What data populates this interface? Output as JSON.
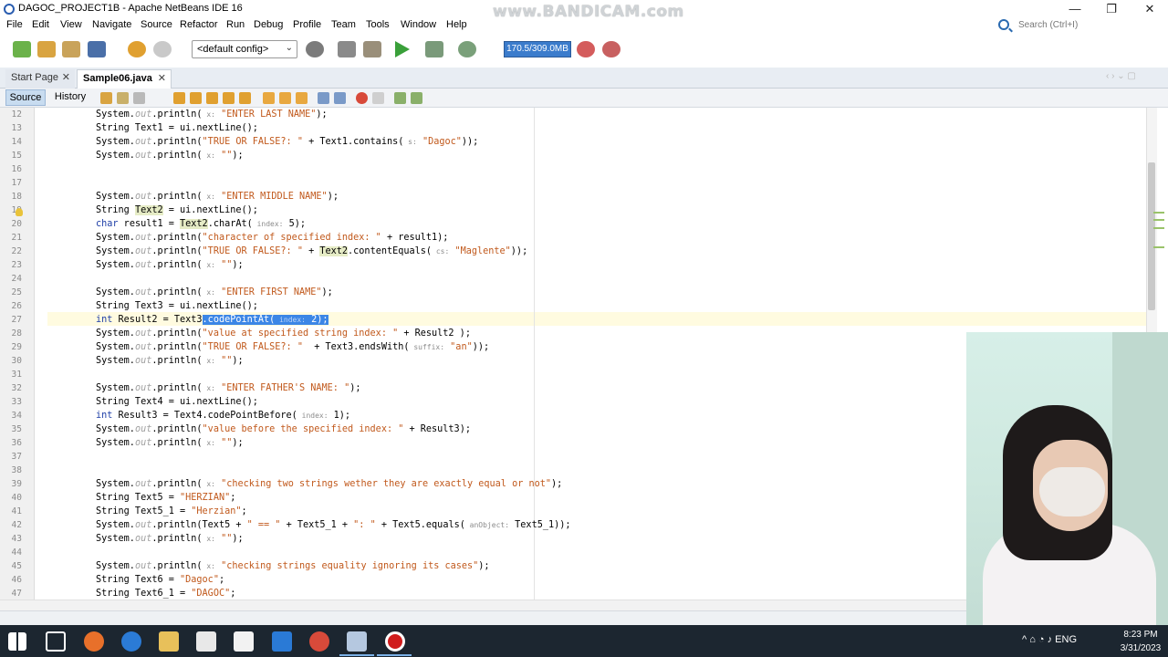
{
  "window": {
    "title": "DAGOC_PROJECT1B - Apache NetBeans IDE 16",
    "watermark": "www.BANDICAM.com",
    "minimize": "—",
    "maximize": "❐",
    "close": "✕"
  },
  "menu": [
    "File",
    "Edit",
    "View",
    "Navigate",
    "Source",
    "Refactor",
    "Run",
    "Debug",
    "Profile",
    "Team",
    "Tools",
    "Window",
    "Help"
  ],
  "search": {
    "placeholder": "Search (Ctrl+I)"
  },
  "toolbar": {
    "config": "<default config>",
    "memory": "170.5/309.0MB"
  },
  "tabs": [
    {
      "label": "Start Page",
      "close": "✕"
    },
    {
      "label": "Sample06.java",
      "close": "✕"
    }
  ],
  "editor_modes": {
    "source": "Source",
    "history": "History"
  },
  "code_lines": [
    {
      "n": "12",
      "text": "System.out.println( x: \"ENTER LAST NAME\");"
    },
    {
      "n": "13",
      "text": "String Text1 = ui.nextLine();"
    },
    {
      "n": "14",
      "text": "System.out.println(\"TRUE OR FALSE?: \" + Text1.contains( s: \"Dagoc\"));"
    },
    {
      "n": "15",
      "text": "System.out.println( x: \"\");"
    },
    {
      "n": "16",
      "text": ""
    },
    {
      "n": "17",
      "text": ""
    },
    {
      "n": "18",
      "text": "System.out.println( x: \"ENTER MIDDLE NAME\");"
    },
    {
      "n": "19",
      "text": "String Text2 = ui.nextLine();"
    },
    {
      "n": "20",
      "text": "char result1 = Text2.charAt( index: 5);"
    },
    {
      "n": "21",
      "text": "System.out.println(\"character of specified index: \" + result1);"
    },
    {
      "n": "22",
      "text": "System.out.println(\"TRUE OR FALSE?: \" + Text2.contentEquals( cs: \"Maglente\"));"
    },
    {
      "n": "23",
      "text": "System.out.println( x: \"\");"
    },
    {
      "n": "24",
      "text": ""
    },
    {
      "n": "25",
      "text": "System.out.println( x: \"ENTER FIRST NAME\");"
    },
    {
      "n": "26",
      "text": "String Text3 = ui.nextLine();"
    },
    {
      "n": "27",
      "text": "int Result2 = Text3.codePointAt( index: 2);"
    },
    {
      "n": "28",
      "text": "System.out.println(\"value at specified string index: \" + Result2 );"
    },
    {
      "n": "29",
      "text": "System.out.println(\"TRUE OR FALSE?: \"  + Text3.endsWith( suffix: \"an\"));"
    },
    {
      "n": "30",
      "text": "System.out.println( x: \"\");"
    },
    {
      "n": "31",
      "text": ""
    },
    {
      "n": "32",
      "text": "System.out.println( x: \"ENTER FATHER'S NAME: \");"
    },
    {
      "n": "33",
      "text": "String Text4 = ui.nextLine();"
    },
    {
      "n": "34",
      "text": "int Result3 = Text4.codePointBefore( index: 1);"
    },
    {
      "n": "35",
      "text": "System.out.println(\"value before the specified index: \" + Result3);"
    },
    {
      "n": "36",
      "text": "System.out.println( x: \"\");"
    },
    {
      "n": "37",
      "text": ""
    },
    {
      "n": "38",
      "text": ""
    },
    {
      "n": "39",
      "text": "System.out.println( x: \"checking two strings wether they are exactly equal or not\");"
    },
    {
      "n": "40",
      "text": "String Text5 = \"HERZIAN\";"
    },
    {
      "n": "41",
      "text": "String Text5_1 = \"Herzian\";"
    },
    {
      "n": "42",
      "text": "System.out.println(Text5 + \" == \" + Text5_1 + \": \" + Text5.equals( anObject: Text5_1));"
    },
    {
      "n": "43",
      "text": "System.out.println( x: \"\");"
    },
    {
      "n": "44",
      "text": ""
    },
    {
      "n": "45",
      "text": "System.out.println( x: \"checking strings equality ignoring its cases\");"
    },
    {
      "n": "46",
      "text": "String Text6 = \"Dagoc\";"
    },
    {
      "n": "47",
      "text": "String Text6_1 = \"DAGOC\";"
    }
  ],
  "taskbar": {
    "time": "8:23 PM",
    "date": "3/31/2023",
    "tray": "^  ⌂  ◔  ♪  ENG"
  }
}
